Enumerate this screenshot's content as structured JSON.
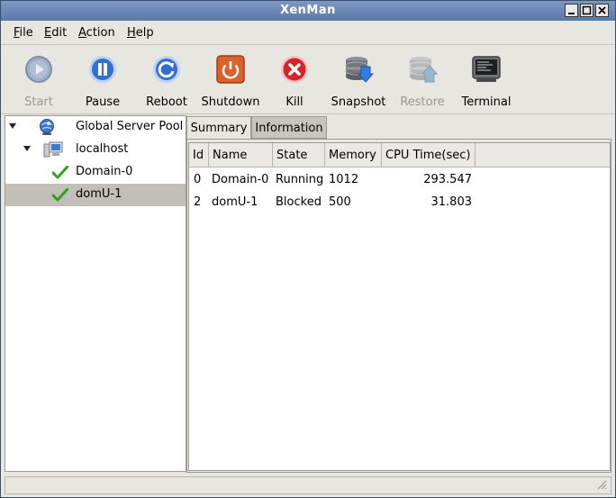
{
  "window": {
    "title": "XenMan"
  },
  "menu": [
    {
      "label": "File",
      "mnemonic": "F",
      "rest": "ile"
    },
    {
      "label": "Edit",
      "mnemonic": "E",
      "rest": "dit"
    },
    {
      "label": "Action",
      "mnemonic": "A",
      "rest": "ction"
    },
    {
      "label": "Help",
      "mnemonic": "H",
      "rest": "elp"
    }
  ],
  "toolbar": {
    "start": "Start",
    "pause": "Pause",
    "reboot": "Reboot",
    "shutdown": "Shutdown",
    "kill": "Kill",
    "snapshot": "Snapshot",
    "restore": "Restore",
    "terminal": "Terminal"
  },
  "tree": {
    "pool": "Global Server Pool",
    "host": "localhost",
    "domains": [
      "Domain-0",
      "domU-1"
    ],
    "selected": "domU-1"
  },
  "tabs": {
    "summary": "Summary",
    "information": "Information",
    "active": "Summary"
  },
  "table": {
    "columns": [
      "Id",
      "Name",
      "State",
      "Memory",
      "CPU Time(sec)"
    ],
    "rows": [
      [
        "0",
        "Domain-0",
        "Running",
        "1012",
        "293.547"
      ],
      [
        "2",
        "domU-1",
        "Blocked",
        "500",
        "31.803"
      ]
    ]
  },
  "colors": {
    "titlebar": "#6a86b6",
    "kill": "#d8232a",
    "shutdown": "#d9622b",
    "pause": "#2f6fd6",
    "check": "#2aa61c"
  }
}
